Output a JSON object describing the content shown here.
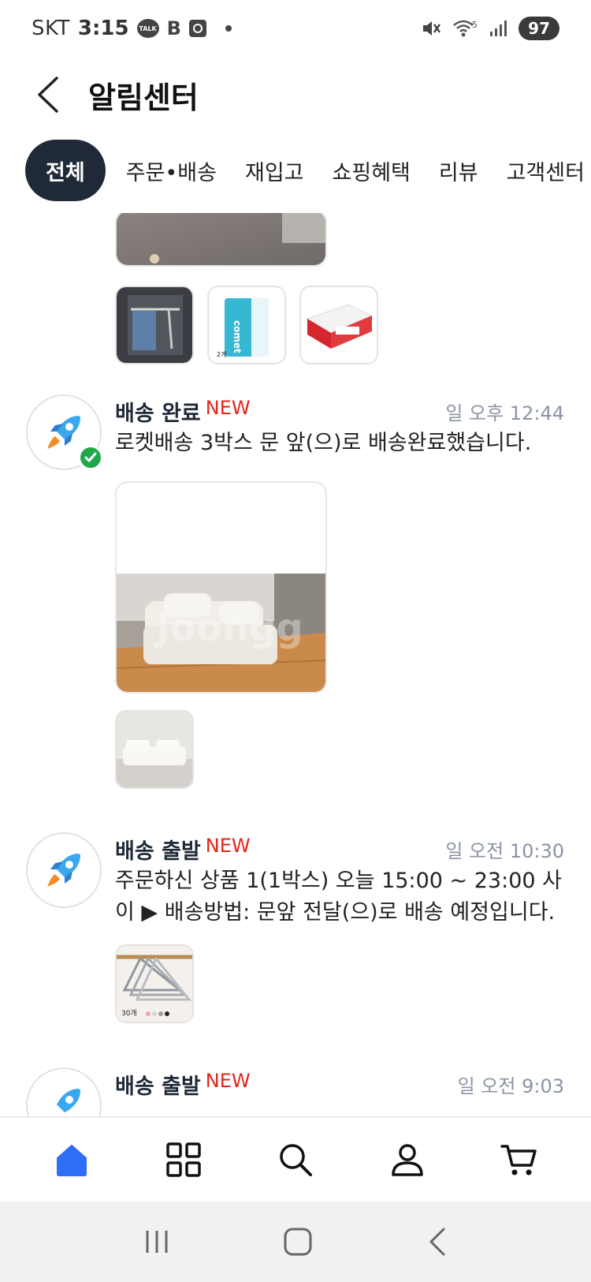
{
  "status_bar": {
    "carrier": "SKT",
    "time": "3:15",
    "talk_badge": "TALK",
    "b_badge": "B",
    "network_label": "5",
    "battery": "97"
  },
  "header": {
    "title": "알림센터"
  },
  "tabs": [
    {
      "label": "전체",
      "active": true
    },
    {
      "label": "주문•배송",
      "active": false
    },
    {
      "label": "재입고",
      "active": false
    },
    {
      "label": "쇼핑혜택",
      "active": false
    },
    {
      "label": "리뷰",
      "active": false
    },
    {
      "label": "고객센터",
      "active": false
    }
  ],
  "thumb_texts": {
    "comet_brand": "comet",
    "comet_count": "2개",
    "hanger_count": "30개"
  },
  "notifications": [
    {
      "title": "배송 완료",
      "new_tag": "NEW",
      "time": "일 오후 12:44",
      "body": "로켓배송 3박스 문 앞(으)로 배송완료했습니다.",
      "watermark": "Joongg"
    },
    {
      "title": "배송 출발",
      "new_tag": "NEW",
      "time": "일 오전 10:30",
      "body": "주문하신 상품 1(1박스) 오늘 15:00 ~ 23:00 사이 ▶ 배송방법: 문앞 전달(으)로 배송 예정입니다."
    },
    {
      "title": "배송 출발",
      "new_tag": "NEW",
      "time": "일 오전 9:03"
    }
  ],
  "bottom_nav": [
    "home-icon",
    "categories-icon",
    "search-icon",
    "my-page-icon",
    "cart-icon"
  ],
  "colors": {
    "active_tab_bg": "#1f2937",
    "new_tag": "#e1251b",
    "home_active": "#2f6df6",
    "success_badge": "#1fa84a"
  }
}
